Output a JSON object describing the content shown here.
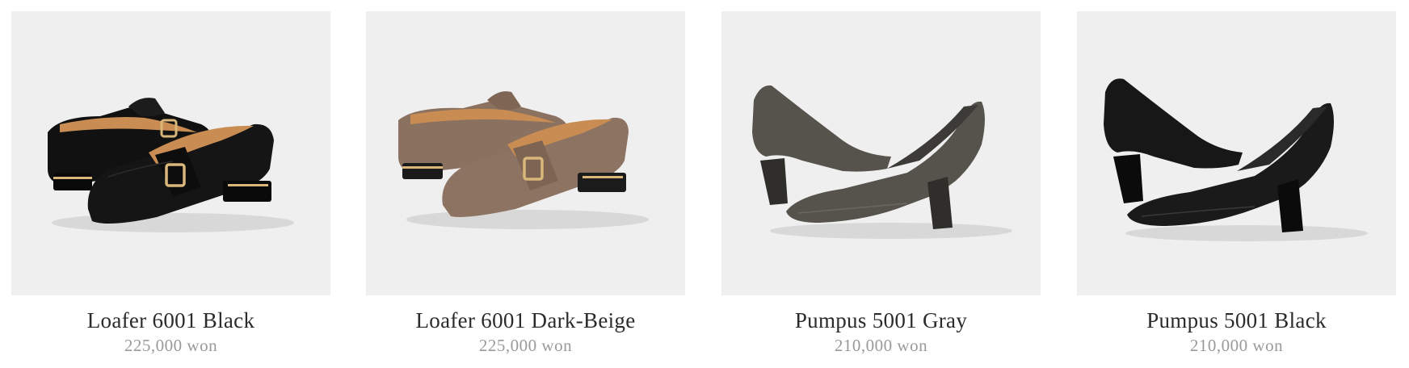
{
  "products": [
    {
      "name": "Loafer 6001 Black",
      "price": "225,000 won",
      "image": "black-buckle-loafer",
      "shoe_color": "#131313",
      "lining_color": "#c98d53"
    },
    {
      "name": "Loafer 6001 Dark-Beige",
      "price": "225,000 won",
      "image": "dark-beige-buckle-loafer",
      "shoe_color": "#8b7160",
      "lining_color": "#c98d53"
    },
    {
      "name": "Pumpus 5001 Gray",
      "price": "210,000 won",
      "image": "gray-block-heel-pump",
      "shoe_color": "#55534c",
      "lining_color": "#3c3b37"
    },
    {
      "name": "Pumpus 5001 Black",
      "price": "210,000 won",
      "image": "black-block-heel-pump",
      "shoe_color": "#171717",
      "lining_color": "#2a2a2a"
    }
  ],
  "colors": {
    "photo_background": "#efefef",
    "title_text": "#2b2b2b",
    "price_text": "#9a9a9a",
    "hardware_gold": "#d9b77a"
  }
}
